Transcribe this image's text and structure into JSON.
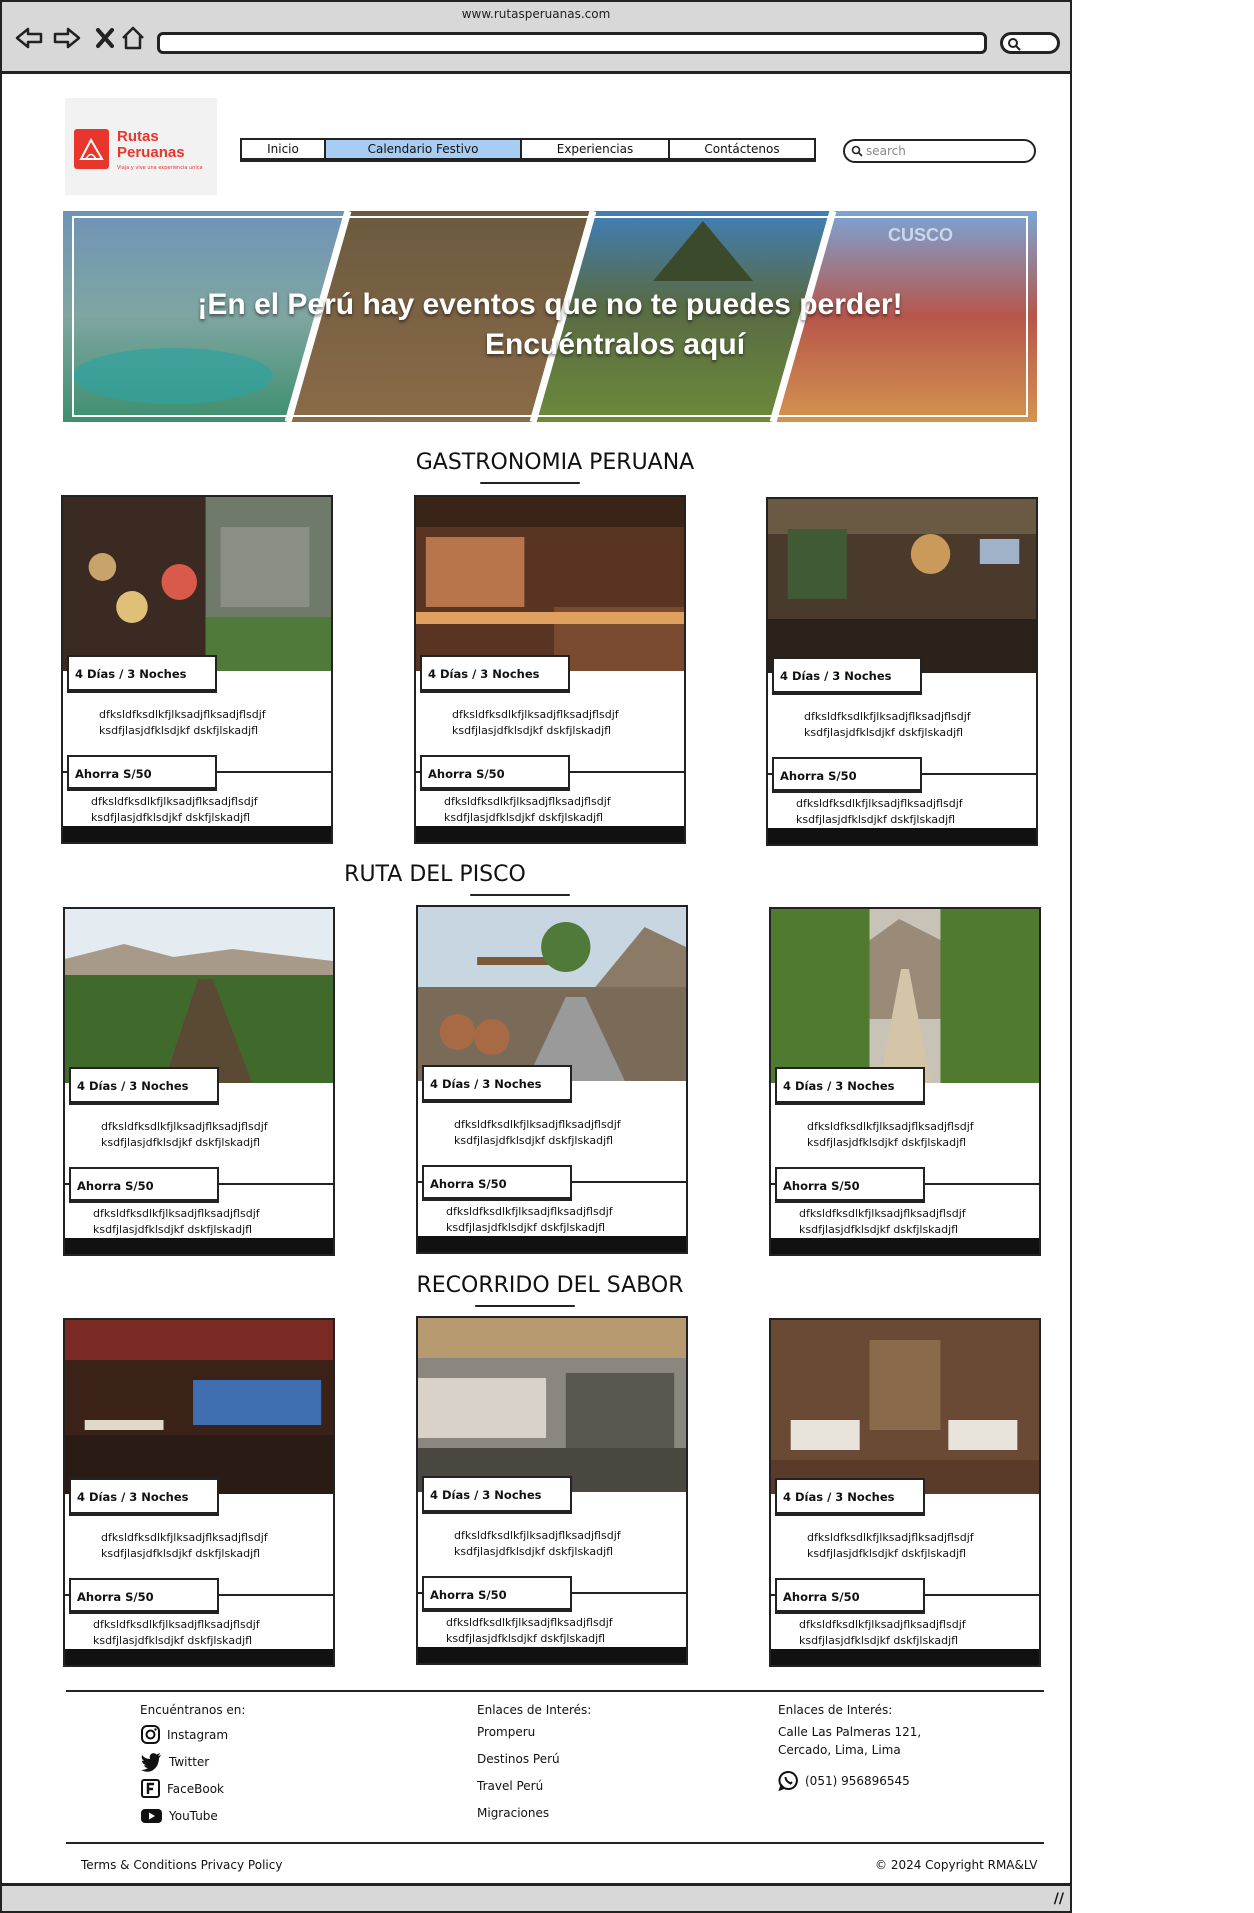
{
  "browser": {
    "url": "www.rutasperuanas.com"
  },
  "logo": {
    "line1": "Rutas",
    "line2": "Peruanas",
    "tagline": "Viaja y vive una experiencia unica"
  },
  "nav": {
    "tabs": [
      {
        "label": "Inicio"
      },
      {
        "label": "Calendario Festivo"
      },
      {
        "label": "Experiencias"
      },
      {
        "label": "Contáctenos"
      }
    ],
    "active_index": 1,
    "search_placeholder": "search"
  },
  "hero": {
    "line1": "¡En el Perú hay eventos que no te puedes perder!",
    "line2": "Encuéntralos aquí",
    "overlay_text": "CUSCO"
  },
  "sections": [
    {
      "title": "GASTRONOMIA PERUANA",
      "cards": [
        {
          "duration": "4 Días / 3 Noches",
          "desc": "dfksldfksdlkfjlksadjflksadjflsdjf ksdfjlasjdfklsdjkf dskfjlskadjfl",
          "price": "Ahorra S/50",
          "desc2": "dfksldfksdlkfjlksadjflksadjflsdjf ksdfjlasjdfklsdjkf dskfjlskadjfl"
        },
        {
          "duration": "4 Días / 3 Noches",
          "desc": "dfksldfksdlkfjlksadjflksadjflsdjf ksdfjlasjdfklsdjkf dskfjlskadjfl",
          "price": "Ahorra S/50",
          "desc2": "dfksldfksdlkfjlksadjflksadjflsdjf ksdfjlasjdfklsdjkf dskfjlskadjfl"
        },
        {
          "duration": "4 Días / 3 Noches",
          "desc": "dfksldfksdlkfjlksadjflksadjflsdjf ksdfjlasjdfklsdjkf dskfjlskadjfl",
          "price": "Ahorra S/50",
          "desc2": "dfksldfksdlkfjlksadjflksadjflsdjf ksdfjlasjdfklsdjkf dskfjlskadjfl"
        }
      ]
    },
    {
      "title": "RUTA DEL PISCO",
      "cards": [
        {
          "duration": "4 Días / 3 Noches",
          "desc": "dfksldfksdlkfjlksadjflksadjflsdjf ksdfjlasjdfklsdjkf dskfjlskadjfl",
          "price": "Ahorra S/50",
          "desc2": "dfksldfksdlkfjlksadjflksadjflsdjf ksdfjlasjdfklsdjkf dskfjlskadjfl"
        },
        {
          "duration": "4 Días / 3 Noches",
          "desc": "dfksldfksdlkfjlksadjflksadjflsdjf ksdfjlasjdfklsdjkf dskfjlskadjfl",
          "price": "Ahorra S/50",
          "desc2": "dfksldfksdlkfjlksadjflksadjflsdjf ksdfjlasjdfklsdjkf dskfjlskadjfl"
        },
        {
          "duration": "4 Días / 3 Noches",
          "desc": "dfksldfksdlkfjlksadjflksadjflsdjf ksdfjlasjdfklsdjkf dskfjlskadjfl",
          "price": "Ahorra S/50",
          "desc2": "dfksldfksdlkfjlksadjflksadjflsdjf ksdfjlasjdfklsdjkf dskfjlskadjfl"
        }
      ]
    },
    {
      "title": "RECORRIDO DEL SABOR",
      "cards": [
        {
          "duration": "4 Días / 3 Noches",
          "desc": "dfksldfksdlkfjlksadjflksadjflsdjf ksdfjlasjdfklsdjkf dskfjlskadjfl",
          "price": "Ahorra S/50",
          "desc2": "dfksldfksdlkfjlksadjflksadjflsdjf ksdfjlasjdfklsdjkf dskfjlskadjfl"
        },
        {
          "duration": "4 Días / 3 Noches",
          "desc": "dfksldfksdlkfjlksadjflksadjflsdjf ksdfjlasjdfklsdjkf dskfjlskadjfl",
          "price": "Ahorra S/50",
          "desc2": "dfksldfksdlkfjlksadjflksadjflsdjf ksdfjlasjdfklsdjkf dskfjlskadjfl"
        },
        {
          "duration": "4 Días / 3 Noches",
          "desc": "dfksldfksdlkfjlksadjflksadjflsdjf ksdfjlasjdfklsdjkf dskfjlskadjfl",
          "price": "Ahorra S/50",
          "desc2": "dfksldfksdlkfjlksadjflksadjflsdjf ksdfjlasjdfklsdjkf dskfjlskadjfl"
        }
      ]
    }
  ],
  "footer": {
    "social": {
      "heading": "Encuéntranos en:",
      "items": [
        {
          "label": "Instagram",
          "icon": "instagram-icon"
        },
        {
          "label": "Twitter",
          "icon": "twitter-icon"
        },
        {
          "label": "FaceBook",
          "icon": "facebook-icon"
        },
        {
          "label": "YouTube",
          "icon": "youtube-icon"
        }
      ]
    },
    "links": {
      "heading": "Enlaces de Interés:",
      "items": [
        "Promperu",
        "Destinos Perú",
        "Travel Perú",
        "Migraciones"
      ]
    },
    "contact": {
      "heading": "Enlaces de Interés:",
      "address_line1": "Calle Las Palmeras 121,",
      "address_line2": "Cercado, Lima, Lima",
      "phone": "(051) 956896545"
    },
    "legal": "Terms & Conditions Privacy Policy",
    "copyright": "© 2024 Copyright RMA&LV"
  },
  "colors": {
    "brand": "#e8362c",
    "active_tab": "#a9cdf2"
  }
}
